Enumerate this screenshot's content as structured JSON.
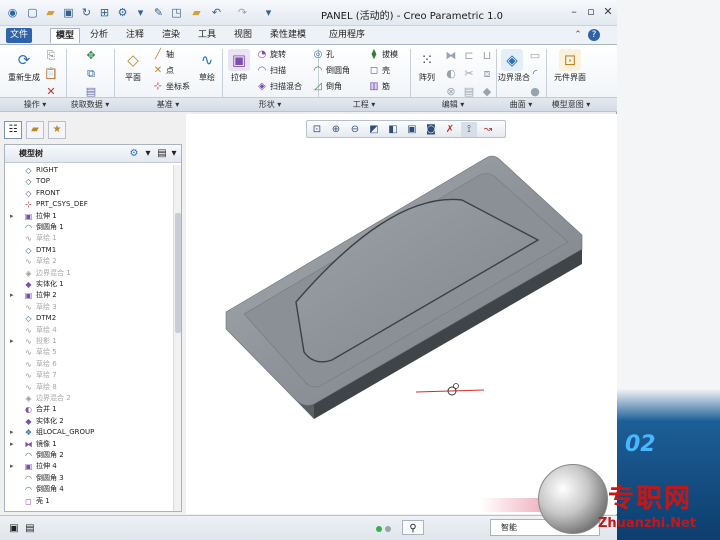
{
  "window": {
    "title": "PANEL (活动的) - Creo Parametric 1.0",
    "quick_access_icons": [
      "new-icon",
      "open-icon",
      "save-icon",
      "regenerate-icon",
      "window-icon",
      "settings-icon",
      "undo-icon",
      "redo-icon",
      "dropdown-icon"
    ]
  },
  "tabs": [
    {
      "label": "文件",
      "kind": "file"
    },
    {
      "label": "模型",
      "kind": "active"
    },
    {
      "label": "分析",
      "kind": "normal"
    },
    {
      "label": "注释",
      "kind": "normal"
    },
    {
      "label": "渲染",
      "kind": "normal"
    },
    {
      "label": "工具",
      "kind": "normal"
    },
    {
      "label": "视图",
      "kind": "normal"
    },
    {
      "label": "柔性建模",
      "kind": "normal"
    },
    {
      "label": "应用程序",
      "kind": "normal"
    }
  ],
  "ribbon": {
    "regenerate": "重新生成",
    "plane": "平面",
    "axis": "轴",
    "point": "点",
    "csys": "坐标系",
    "sketch": "草绘",
    "extrude": "拉伸",
    "revolve": "旋转",
    "sweep": "扫描",
    "helical_sweep": "扫描混合",
    "hole": "孔",
    "round": "倒圆角",
    "chamfer": "倒角",
    "draft": "拔模",
    "shell": "壳",
    "rib": "筋",
    "pattern": "阵列",
    "boundary_blend": "边界混合",
    "component_interface": "元件界面"
  },
  "groups": [
    {
      "label": "操作 ▾"
    },
    {
      "label": "获取数据 ▾"
    },
    {
      "label": "基准 ▾"
    },
    {
      "label": "形状 ▾"
    },
    {
      "label": "工程 ▾"
    },
    {
      "label": "编辑 ▾"
    },
    {
      "label": "曲面 ▾"
    },
    {
      "label": "模型意图 ▾"
    }
  ],
  "model_tree": {
    "title": "模型树",
    "items": [
      {
        "label": "RIGHT",
        "icon": "◇",
        "icon_color": "#3a5a88",
        "expand": "",
        "dim": false
      },
      {
        "label": "TOP",
        "icon": "◇",
        "icon_color": "#3a5a88",
        "expand": "",
        "dim": false
      },
      {
        "label": "FRONT",
        "icon": "◇",
        "icon_color": "#3a5a88",
        "expand": "",
        "dim": false
      },
      {
        "label": "PRT_CSYS_DEF",
        "icon": "⊹",
        "icon_color": "#c03030",
        "expand": "",
        "dim": false
      },
      {
        "label": "拉伸 1",
        "icon": "▣",
        "icon_color": "#7a4fb0",
        "expand": "▸",
        "dim": false
      },
      {
        "label": "倒圆角 1",
        "icon": "◠",
        "icon_color": "#3a7a3a",
        "expand": "",
        "dim": false
      },
      {
        "label": "草绘 1",
        "icon": "∿",
        "icon_color": "#999999",
        "expand": "",
        "dim": true
      },
      {
        "label": "DTM1",
        "icon": "◇",
        "icon_color": "#3a5a88",
        "expand": "",
        "dim": false
      },
      {
        "label": "草绘 2",
        "icon": "∿",
        "icon_color": "#999999",
        "expand": "",
        "dim": true
      },
      {
        "label": "边界混合 1",
        "icon": "◈",
        "icon_color": "#999999",
        "expand": "",
        "dim": true
      },
      {
        "label": "实体化 1",
        "icon": "◆",
        "icon_color": "#7a4fb0",
        "expand": "",
        "dim": false
      },
      {
        "label": "拉伸 2",
        "icon": "▣",
        "icon_color": "#7a4fb0",
        "expand": "▸",
        "dim": false
      },
      {
        "label": "草绘 3",
        "icon": "∿",
        "icon_color": "#999999",
        "expand": "",
        "dim": true
      },
      {
        "label": "DTM2",
        "icon": "◇",
        "icon_color": "#3a5a88",
        "expand": "",
        "dim": false
      },
      {
        "label": "草绘 4",
        "icon": "∿",
        "icon_color": "#999999",
        "expand": "",
        "dim": true
      },
      {
        "label": "投影 1",
        "icon": "∿",
        "icon_color": "#999999",
        "expand": "▸",
        "dim": true
      },
      {
        "label": "草绘 5",
        "icon": "∿",
        "icon_color": "#999999",
        "expand": "",
        "dim": true
      },
      {
        "label": "草绘 6",
        "icon": "∿",
        "icon_color": "#999999",
        "expand": "",
        "dim": true
      },
      {
        "label": "草绘 7",
        "icon": "∿",
        "icon_color": "#999999",
        "expand": "",
        "dim": true
      },
      {
        "label": "草绘 8",
        "icon": "∿",
        "icon_color": "#999999",
        "expand": "",
        "dim": true
      },
      {
        "label": "边界混合 2",
        "icon": "◈",
        "icon_color": "#999999",
        "expand": "",
        "dim": true
      },
      {
        "label": "合并 1",
        "icon": "◐",
        "icon_color": "#7a4fb0",
        "expand": "",
        "dim": false
      },
      {
        "label": "实体化 2",
        "icon": "◆",
        "icon_color": "#7a4fb0",
        "expand": "",
        "dim": false
      },
      {
        "label": "组LOCAL_GROUP",
        "icon": "❖",
        "icon_color": "#2d6e9e",
        "expand": "▸",
        "dim": false
      },
      {
        "label": "镜像 1",
        "icon": "⧓",
        "icon_color": "#7a4fb0",
        "expand": "▸",
        "dim": false
      },
      {
        "label": "倒圆角 2",
        "icon": "◠",
        "icon_color": "#3a7a3a",
        "expand": "",
        "dim": false
      },
      {
        "label": "拉伸 4",
        "icon": "▣",
        "icon_color": "#7a4fb0",
        "expand": "▸",
        "dim": false
      },
      {
        "label": "倒圆角 3",
        "icon": "◠",
        "icon_color": "#3a7a3a",
        "expand": "",
        "dim": false
      },
      {
        "label": "倒圆角 4",
        "icon": "◠",
        "icon_color": "#3a7a3a",
        "expand": "",
        "dim": false
      },
      {
        "label": "壳 1",
        "icon": "◻",
        "icon_color": "#7a4fb0",
        "expand": "",
        "dim": false
      }
    ]
  },
  "view_toolbar": [
    "refit-icon",
    "zoom-in-icon",
    "zoom-out-icon",
    "repaint-icon",
    "shading-icon",
    "saved-views-icon",
    "view-manager-icon",
    "datum-display-icon",
    "spin-center-icon",
    "annotation-icon"
  ],
  "status": {
    "filter": "智能"
  },
  "desktop": {
    "banner": "02"
  },
  "watermark": {
    "title": "专职网",
    "url": "Zhuanzhi.Net"
  },
  "colors": {
    "accent": "#2f63a8",
    "model_top": "#8c9298",
    "model_side": "#3f4448"
  }
}
